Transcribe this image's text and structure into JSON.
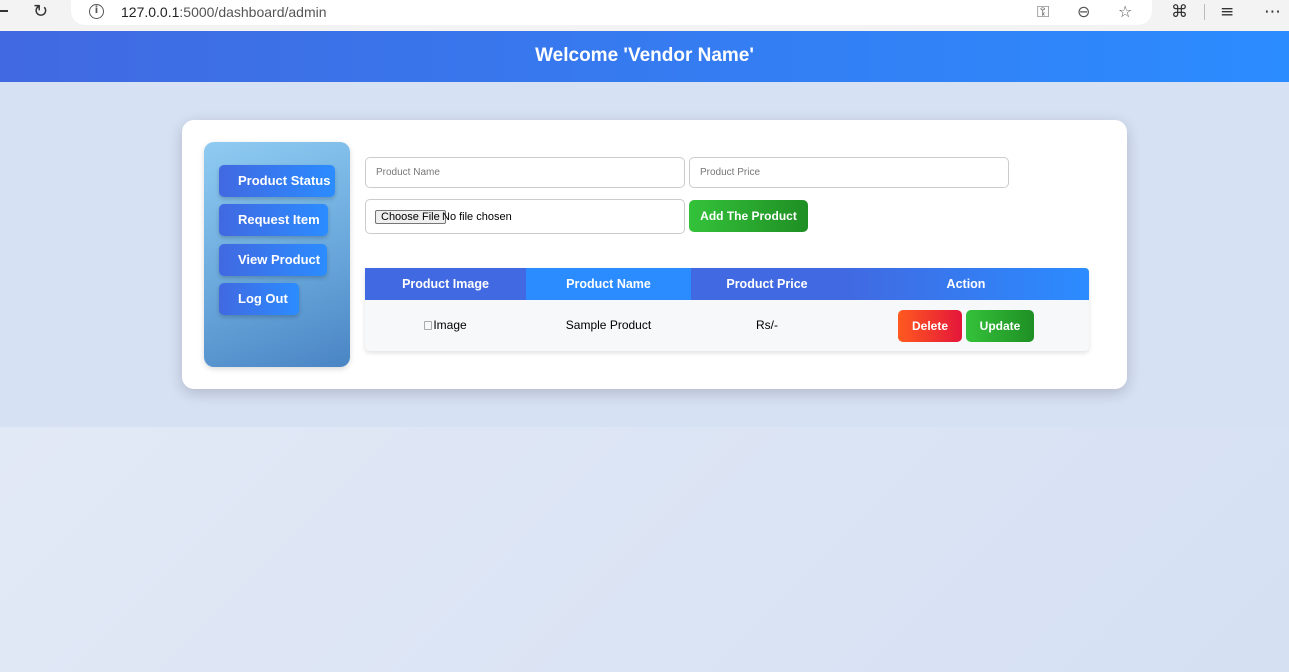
{
  "browser": {
    "url_host": "127.0.0.1",
    "url_path": ":5000/dashboard/admin",
    "icons": [
      "back-icon",
      "reload-icon",
      "info-icon",
      "key-icon",
      "zoom-out-icon",
      "star-icon",
      "extensions-icon",
      "favorites-icon",
      "more-icon"
    ]
  },
  "header": {
    "title": "Welcome 'Vendor Name'"
  },
  "sidebar": {
    "items": [
      {
        "label": "Product Status"
      },
      {
        "label": "Request Item"
      },
      {
        "label": "View Product"
      },
      {
        "label": "Log Out"
      }
    ]
  },
  "form": {
    "product_name_placeholder": "Product Name",
    "product_price_placeholder": "Product Price",
    "choose_file_label": "Choose File",
    "file_status": "No file chosen",
    "add_button": "Add The Product"
  },
  "table": {
    "headers": [
      "Product Image",
      "Product Name",
      "Product Price",
      "Action"
    ],
    "rows": [
      {
        "image_alt": "Image",
        "name": "Sample Product",
        "price": "Rs/-",
        "delete": "Delete",
        "update": "Update"
      }
    ]
  },
  "colors": {
    "primary_blue": "#4169e1",
    "accent_blue": "#2b8cff",
    "green": "#2ea833",
    "red": "#e4163a"
  }
}
